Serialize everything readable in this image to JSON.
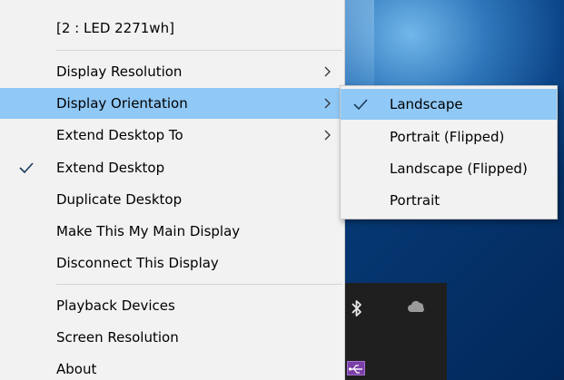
{
  "menu": {
    "header": "[2 : LED 2271wh]",
    "items": [
      {
        "label": "Display Resolution",
        "submenu": true,
        "checked": false,
        "highlighted": false
      },
      {
        "label": "Display Orientation",
        "submenu": true,
        "checked": false,
        "highlighted": true
      },
      {
        "label": "Extend Desktop To",
        "submenu": true,
        "checked": false,
        "highlighted": false
      },
      {
        "label": "Extend Desktop",
        "submenu": false,
        "checked": true,
        "highlighted": false
      },
      {
        "label": "Duplicate Desktop",
        "submenu": false,
        "checked": false,
        "highlighted": false
      },
      {
        "label": "Make This My Main Display",
        "submenu": false,
        "checked": false,
        "highlighted": false
      },
      {
        "label": "Disconnect This Display",
        "submenu": false,
        "checked": false,
        "highlighted": false
      },
      {
        "label": "Playback Devices",
        "submenu": false,
        "checked": false,
        "highlighted": false
      },
      {
        "label": "Screen Resolution",
        "submenu": false,
        "checked": false,
        "highlighted": false
      },
      {
        "label": "About",
        "submenu": false,
        "checked": false,
        "highlighted": false
      }
    ]
  },
  "submenu": {
    "items": [
      {
        "label": "Landscape",
        "checked": true,
        "highlighted": true
      },
      {
        "label": "Portrait (Flipped)",
        "checked": false,
        "highlighted": false
      },
      {
        "label": "Landscape (Flipped)",
        "checked": false,
        "highlighted": false
      },
      {
        "label": "Portrait",
        "checked": false,
        "highlighted": false
      }
    ]
  },
  "tray": {
    "icons": [
      "bluetooth-icon",
      "onedrive-cloud-icon",
      "usb-icon"
    ]
  },
  "colors": {
    "menu_bg": "#f2f2f2",
    "highlight": "#90c8f6",
    "check": "#1a3a5c",
    "desktop": "#0a3f7d",
    "tray_bg": "#1f1f1f"
  }
}
